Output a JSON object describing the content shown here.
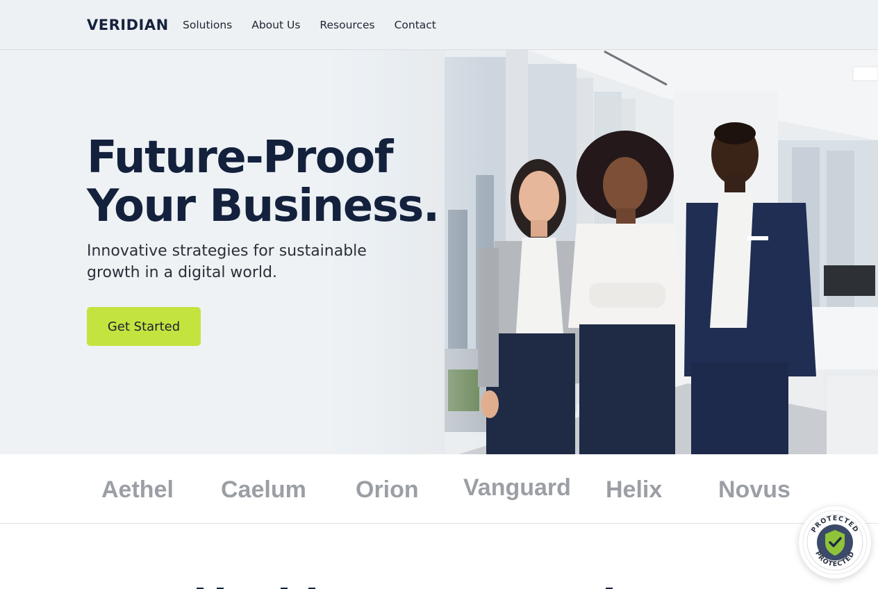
{
  "brand": {
    "logo_text": "ERIDIAN",
    "logo_letter": "V",
    "accent": "#9bcf2f",
    "navy": "#15223d"
  },
  "nav": {
    "items": [
      {
        "label": "Solutions"
      },
      {
        "label": "About Us"
      },
      {
        "label": "Resources"
      },
      {
        "label": "Contact"
      }
    ]
  },
  "hero": {
    "title_line1": "Future-Proof",
    "title_line2": "Your Business.",
    "subtitle_line1": "Innovative strategies for sustainable",
    "subtitle_line2": "growth in a digital world.",
    "cta_label": "Get Started",
    "cta_color": "#c3e43f"
  },
  "partners": [
    "Aethel",
    "Caelum",
    "Orion",
    "Vanguard",
    "Helix",
    "Novus"
  ],
  "badge": {
    "text": "PROTECTED",
    "icon": "shield-check-icon"
  }
}
